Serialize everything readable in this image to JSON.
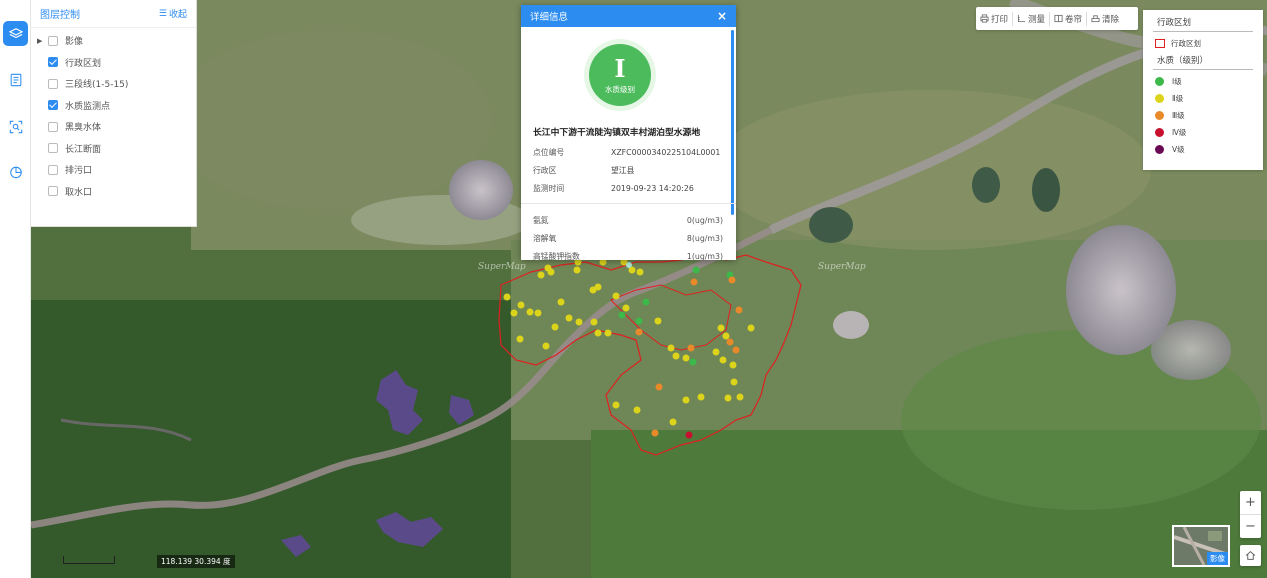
{
  "rail": {
    "items": [
      {
        "name": "layers",
        "icon": "layers-icon",
        "active": true
      },
      {
        "name": "list",
        "icon": "list-icon",
        "active": false
      },
      {
        "name": "search",
        "icon": "search-icon",
        "active": false
      },
      {
        "name": "stats",
        "icon": "pie-chart-icon",
        "active": false
      }
    ]
  },
  "layer_panel": {
    "title": "图层控制",
    "collapse_label": "收起",
    "items": [
      {
        "label": "影像",
        "checked": false,
        "expandable": true
      },
      {
        "label": "行政区划",
        "checked": true
      },
      {
        "label": "三段线(1-5-15)",
        "checked": false
      },
      {
        "label": "水质监测点",
        "checked": true
      },
      {
        "label": "黑臭水体",
        "checked": false
      },
      {
        "label": "长江断面",
        "checked": false
      },
      {
        "label": "排污口",
        "checked": false
      },
      {
        "label": "取水口",
        "checked": false
      }
    ]
  },
  "popup": {
    "title": "详细信息",
    "close": "×",
    "grade_numeral": "I",
    "grade_label": "水质级别",
    "site_name": "长江中下游干流陡沟镇双丰村湖泊型水源地",
    "fields": [
      {
        "key": "点位编号",
        "value": "XZFC0000340225104L0001"
      },
      {
        "key": "行政区",
        "value": "望江县"
      },
      {
        "key": "监测时间",
        "value": "2019-09-23 14:20:26"
      }
    ],
    "metrics": [
      {
        "key": "氨氮",
        "value": "0(ug/m3)"
      },
      {
        "key": "溶解氧",
        "value": "8(ug/m3)"
      },
      {
        "key": "高锰酸钾指数",
        "value": "1(ug/m3)"
      }
    ]
  },
  "toolbar": {
    "print": "打印",
    "measure": "测量",
    "shutter": "卷帘",
    "clear": "清除"
  },
  "legend": {
    "section1_title": "行政区划",
    "region_label": "行政区划",
    "section2_title": "水质（级别）",
    "grades": [
      {
        "label": "Ⅰ级",
        "color": "#3db84a"
      },
      {
        "label": "Ⅱ级",
        "color": "#dcd31b"
      },
      {
        "label": "Ⅲ级",
        "color": "#e8892a"
      },
      {
        "label": "Ⅳ级",
        "color": "#c8102e"
      },
      {
        "label": "Ⅴ级",
        "color": "#6a0a55"
      }
    ]
  },
  "map": {
    "watermark": "SuperMap",
    "coordinates": "118.139  30.394  度",
    "basemap_label": "影像",
    "zoom_in": "+",
    "zoom_out": "−",
    "boundary_color": "#e02020"
  }
}
